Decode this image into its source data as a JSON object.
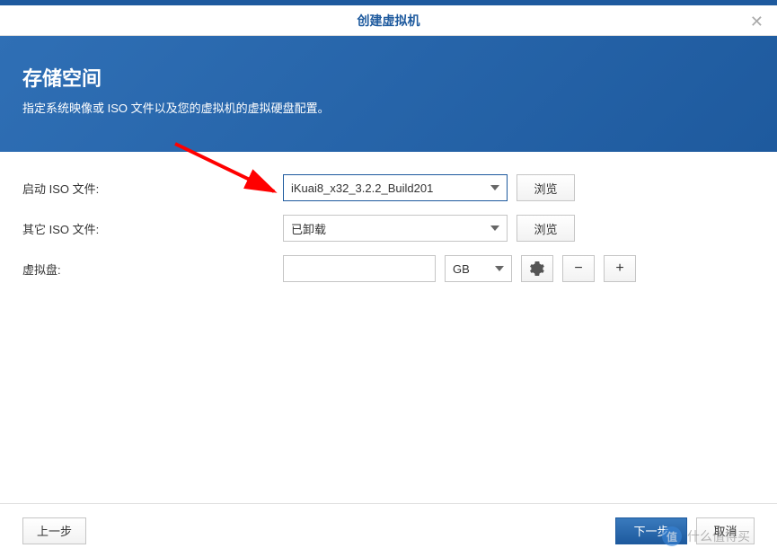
{
  "titlebar": {
    "title": "创建虚拟机"
  },
  "banner": {
    "title": "存储空间",
    "desc": "指定系统映像或 ISO 文件以及您的虚拟机的虚拟硬盘配置。"
  },
  "form": {
    "boot_iso": {
      "label": "启动 ISO 文件:",
      "value": "iKuai8_x32_3.2.2_Build201",
      "browse": "浏览"
    },
    "other_iso": {
      "label": "其它 ISO 文件:",
      "value": "已卸载",
      "browse": "浏览"
    },
    "vdisk": {
      "label": "虚拟盘:",
      "size": "",
      "unit": "GB",
      "gear": "✿",
      "minus": "−",
      "plus": "+"
    }
  },
  "footer": {
    "prev": "上一步",
    "next": "下一步",
    "cancel": "取消"
  },
  "watermark": {
    "badge": "值",
    "text": "什么值得买"
  }
}
